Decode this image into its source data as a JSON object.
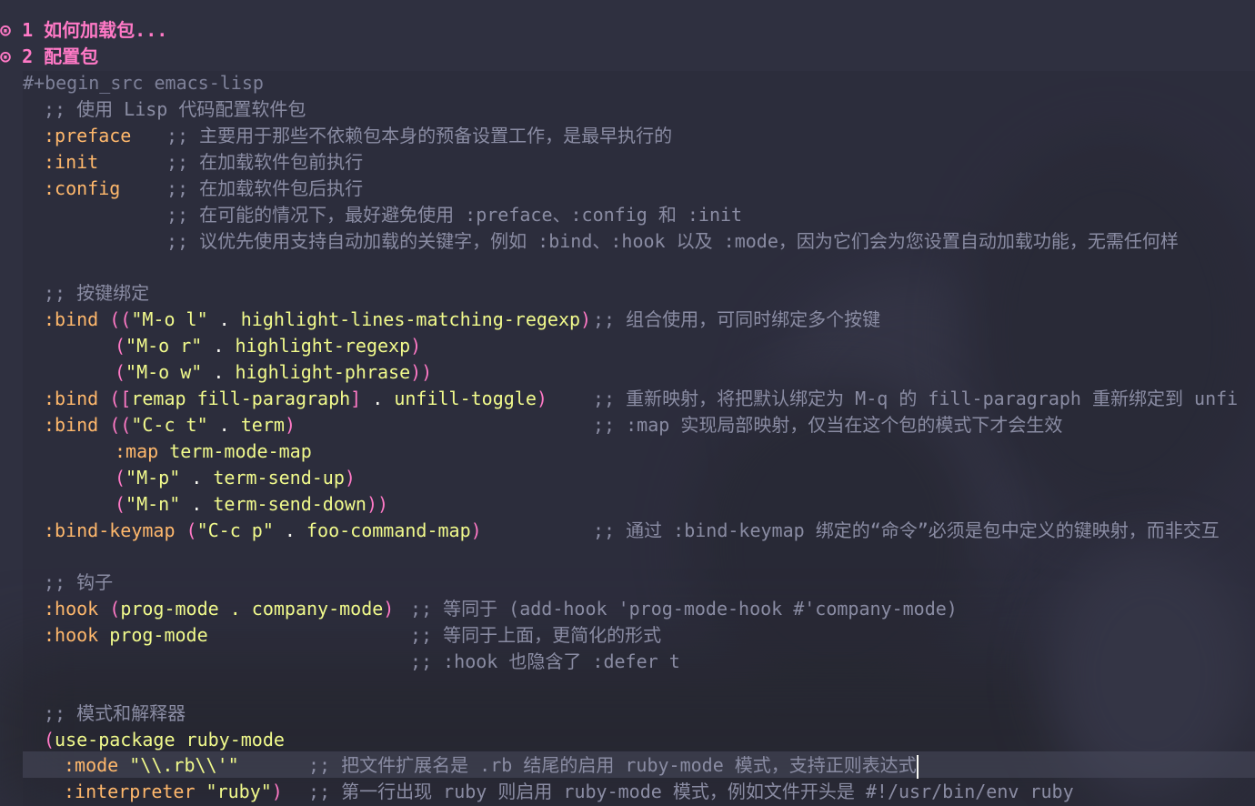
{
  "headings": [
    {
      "bullet": "⊙",
      "text": "1 如何加载包..."
    },
    {
      "bullet": "⊙",
      "text": "2 配置包"
    }
  ],
  "src_begin": "#+begin_src emacs-lisp",
  "lines": {
    "l3": ";; 使用 Lisp 代码配置软件包",
    "l4_kw": ":preface",
    "l4_c": ";; 主要用于那些不依赖包本身的预备设置工作，是最早执行的",
    "l5_kw": ":init",
    "l5_c": ";; 在加载软件包前执行",
    "l6_kw": ":config",
    "l6_c": ";; 在加载软件包后执行",
    "l7_c": ";; 在可能的情况下，最好避免使用 :preface、:config 和 :init",
    "l8_c": ";; 议优先使用支持自动加载的关键字，例如 :bind、:hook 以及 :mode，因为它们会为您设置自动加载功能，无需任何样",
    "l10": ";; 按键绑定",
    "l11_kw": ":bind",
    "l11_a": " ((",
    "l11_s": "\"M-o l\"",
    "l11_b": " . ",
    "l11_f": "highlight-lines-matching-regexp",
    "l11_e": ")",
    "l11_c": ";; 组合使用，可同时绑定多个按键",
    "l12_s": "\"M-o r\"",
    "l12_f": "highlight-regexp",
    "l13_s": "\"M-o w\"",
    "l13_f": "highlight-phrase",
    "l14_kw": ":bind",
    "l14_f1": "remap fill-paragraph",
    "l14_f2": "unfill-toggle",
    "l14_c": ";; 重新映射，将把默认绑定为 M-q 的 fill-paragraph 重新绑定到 unfi",
    "l15_kw": ":bind",
    "l15_s": "\"C-c t\"",
    "l15_f": "term",
    "l15_c": ";; :map 实现局部映射，仅当在这个包的模式下才会生效",
    "l16_kw": ":map",
    "l16_f": "term-mode-map",
    "l17_s": "\"M-p\"",
    "l17_f": "term-send-up",
    "l18_s": "\"M-n\"",
    "l18_f": "term-send-down",
    "l19_kw": ":bind-keymap",
    "l19_s": "\"C-c p\"",
    "l19_f": "foo-command-map",
    "l19_c": ";; 通过 :bind-keymap 绑定的“命令”必须是包中定义的键映射，而非交互",
    "l21": ";; 钩子",
    "l22_kw": ":hook",
    "l22_f": "prog-mode . company-mode",
    "l22_c": ";; 等同于 (add-hook 'prog-mode-hook #'company-mode)",
    "l23_kw": ":hook",
    "l23_f": "prog-mode",
    "l23_c": ";; 等同于上面，更简化的形式",
    "l24_c": ";; :hook 也隐含了 :defer t",
    "l26": ";; 模式和解释器",
    "l27_f": "use-package ruby-mode",
    "l28_kw": ":mode",
    "l28_s": "\"\\\\.rb\\\\'\"",
    "l28_c": ";; 把文件扩展名是 .rb 结尾的启用 ruby-mode 模式，支持正则表达式",
    "l29_kw": ":interpreter",
    "l29_s": "\"ruby\"",
    "l29_c": ";; 第一行出现 ruby 则启用 ruby-mode 模式，例如文件开头是 #!/usr/bin/env ruby"
  }
}
